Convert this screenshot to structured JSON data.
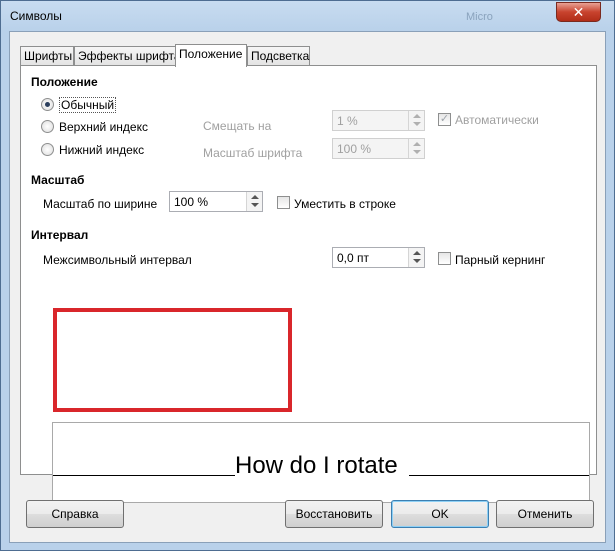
{
  "window": {
    "title": "Символы",
    "background_title_fragment": "Micro",
    "close_glyph": "✕"
  },
  "tabs": [
    {
      "label": "Шрифты"
    },
    {
      "label": "Эффекты шрифта"
    },
    {
      "label": "Положение",
      "active": true
    },
    {
      "label": "Подсветка"
    }
  ],
  "position": {
    "heading": "Положение",
    "radios": [
      {
        "label": "Обычный",
        "selected": true
      },
      {
        "label": "Верхний индекс",
        "selected": false
      },
      {
        "label": "Нижний индекс",
        "selected": false
      }
    ],
    "raise_by": {
      "label": "Смещать на",
      "value": "1 %",
      "enabled": false
    },
    "relative_size": {
      "label": "Масштаб шрифта",
      "value": "100 %",
      "enabled": false
    },
    "automatic": {
      "label": "Автоматически",
      "checked": true,
      "enabled": false
    }
  },
  "scale": {
    "heading": "Масштаб",
    "scale_width": {
      "label": "Масштаб по ширине",
      "value": "100 %"
    },
    "fit_to_line": {
      "label": "Уместить в строке",
      "checked": false
    }
  },
  "spacing": {
    "heading": "Интервал",
    "character_spacing": {
      "label": "Межсимвольный интервал",
      "value": "0,0 пт"
    },
    "pair_kerning": {
      "label": "Парный кернинг",
      "checked": false
    }
  },
  "preview": {
    "text": "How do I rotate"
  },
  "colors": {
    "highlight_box": "#d9262b"
  },
  "buttons": {
    "help": "Справка",
    "reset": "Восстановить",
    "ok": "OK",
    "cancel": "Отменить"
  }
}
